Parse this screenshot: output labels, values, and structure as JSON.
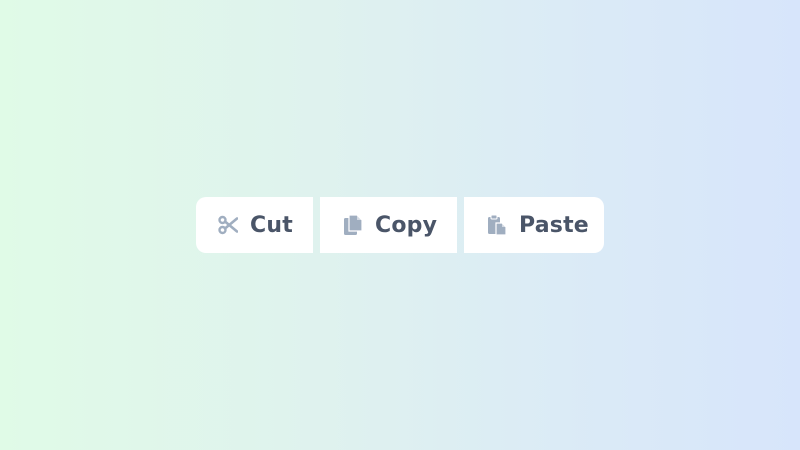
{
  "toolbar": {
    "buttons": [
      {
        "id": "cut",
        "label": "Cut",
        "icon": "scissors-icon"
      },
      {
        "id": "copy",
        "label": "Copy",
        "icon": "copy-icon"
      },
      {
        "id": "paste",
        "label": "Paste",
        "icon": "paste-icon"
      }
    ]
  },
  "colors": {
    "icon": "#a0aec0",
    "label": "#4a5568",
    "button_bg": "#ffffff"
  }
}
